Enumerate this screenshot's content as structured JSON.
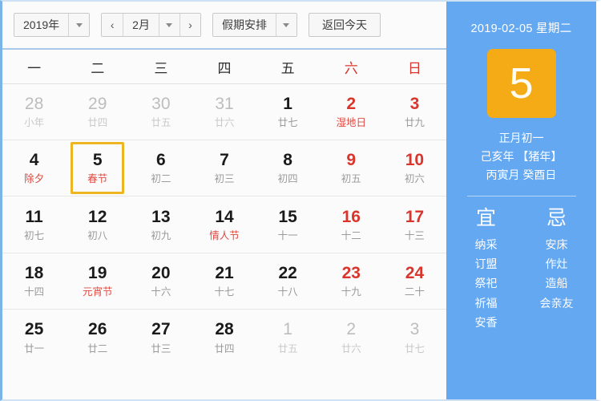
{
  "toolbar": {
    "year_label": "2019年",
    "year_caret": "chevron-down-icon",
    "prev_label": "‹",
    "month_label": "2月",
    "month_caret": "chevron-down-icon",
    "next_label": "›",
    "holiday_label": "假期安排",
    "holiday_caret": "chevron-down-icon",
    "today_label": "返回今天"
  },
  "weekdays": [
    {
      "label": "一",
      "weekend": false
    },
    {
      "label": "二",
      "weekend": false
    },
    {
      "label": "三",
      "weekend": false
    },
    {
      "label": "四",
      "weekend": false
    },
    {
      "label": "五",
      "weekend": false
    },
    {
      "label": "六",
      "weekend": true
    },
    {
      "label": "日",
      "weekend": true
    }
  ],
  "days": [
    {
      "num": "28",
      "sub": "小年",
      "muted": true,
      "num_red": false,
      "sub_red": false,
      "selected": false
    },
    {
      "num": "29",
      "sub": "廿四",
      "muted": true,
      "num_red": false,
      "sub_red": false,
      "selected": false
    },
    {
      "num": "30",
      "sub": "廿五",
      "muted": true,
      "num_red": false,
      "sub_red": false,
      "selected": false
    },
    {
      "num": "31",
      "sub": "廿六",
      "muted": true,
      "num_red": false,
      "sub_red": false,
      "selected": false
    },
    {
      "num": "1",
      "sub": "廿七",
      "muted": false,
      "num_red": false,
      "sub_red": false,
      "selected": false
    },
    {
      "num": "2",
      "sub": "湿地日",
      "muted": false,
      "num_red": true,
      "sub_red": true,
      "selected": false
    },
    {
      "num": "3",
      "sub": "廿九",
      "muted": false,
      "num_red": true,
      "sub_red": false,
      "selected": false
    },
    {
      "num": "4",
      "sub": "除夕",
      "muted": false,
      "num_red": false,
      "sub_red": true,
      "selected": false
    },
    {
      "num": "5",
      "sub": "春节",
      "muted": false,
      "num_red": false,
      "sub_red": true,
      "selected": true
    },
    {
      "num": "6",
      "sub": "初二",
      "muted": false,
      "num_red": false,
      "sub_red": false,
      "selected": false
    },
    {
      "num": "7",
      "sub": "初三",
      "muted": false,
      "num_red": false,
      "sub_red": false,
      "selected": false
    },
    {
      "num": "8",
      "sub": "初四",
      "muted": false,
      "num_red": false,
      "sub_red": false,
      "selected": false
    },
    {
      "num": "9",
      "sub": "初五",
      "muted": false,
      "num_red": true,
      "sub_red": false,
      "selected": false
    },
    {
      "num": "10",
      "sub": "初六",
      "muted": false,
      "num_red": true,
      "sub_red": false,
      "selected": false
    },
    {
      "num": "11",
      "sub": "初七",
      "muted": false,
      "num_red": false,
      "sub_red": false,
      "selected": false
    },
    {
      "num": "12",
      "sub": "初八",
      "muted": false,
      "num_red": false,
      "sub_red": false,
      "selected": false
    },
    {
      "num": "13",
      "sub": "初九",
      "muted": false,
      "num_red": false,
      "sub_red": false,
      "selected": false
    },
    {
      "num": "14",
      "sub": "情人节",
      "muted": false,
      "num_red": false,
      "sub_red": true,
      "selected": false
    },
    {
      "num": "15",
      "sub": "十一",
      "muted": false,
      "num_red": false,
      "sub_red": false,
      "selected": false
    },
    {
      "num": "16",
      "sub": "十二",
      "muted": false,
      "num_red": true,
      "sub_red": false,
      "selected": false
    },
    {
      "num": "17",
      "sub": "十三",
      "muted": false,
      "num_red": true,
      "sub_red": false,
      "selected": false
    },
    {
      "num": "18",
      "sub": "十四",
      "muted": false,
      "num_red": false,
      "sub_red": false,
      "selected": false
    },
    {
      "num": "19",
      "sub": "元宵节",
      "muted": false,
      "num_red": false,
      "sub_red": true,
      "selected": false
    },
    {
      "num": "20",
      "sub": "十六",
      "muted": false,
      "num_red": false,
      "sub_red": false,
      "selected": false
    },
    {
      "num": "21",
      "sub": "十七",
      "muted": false,
      "num_red": false,
      "sub_red": false,
      "selected": false
    },
    {
      "num": "22",
      "sub": "十八",
      "muted": false,
      "num_red": false,
      "sub_red": false,
      "selected": false
    },
    {
      "num": "23",
      "sub": "十九",
      "muted": false,
      "num_red": true,
      "sub_red": false,
      "selected": false
    },
    {
      "num": "24",
      "sub": "二十",
      "muted": false,
      "num_red": true,
      "sub_red": false,
      "selected": false
    },
    {
      "num": "25",
      "sub": "廿一",
      "muted": false,
      "num_red": false,
      "sub_red": false,
      "selected": false
    },
    {
      "num": "26",
      "sub": "廿二",
      "muted": false,
      "num_red": false,
      "sub_red": false,
      "selected": false
    },
    {
      "num": "27",
      "sub": "廿三",
      "muted": false,
      "num_red": false,
      "sub_red": false,
      "selected": false
    },
    {
      "num": "28",
      "sub": "廿四",
      "muted": false,
      "num_red": false,
      "sub_red": false,
      "selected": false
    },
    {
      "num": "1",
      "sub": "廿五",
      "muted": true,
      "num_red": false,
      "sub_red": false,
      "selected": false
    },
    {
      "num": "2",
      "sub": "廿六",
      "muted": true,
      "num_red": false,
      "sub_red": false,
      "selected": false
    },
    {
      "num": "3",
      "sub": "廿七",
      "muted": true,
      "num_red": false,
      "sub_red": false,
      "selected": false
    }
  ],
  "side": {
    "date_line": "2019-02-05 星期二",
    "big_day": "5",
    "lunar_day": "正月初一",
    "lunar_year": "己亥年 【猪年】",
    "lunar_ganzhi": "丙寅月 癸酉日",
    "yi": {
      "title": "宜",
      "items": [
        "纳采",
        "订盟",
        "祭祀",
        "祈福",
        "安香"
      ]
    },
    "ji": {
      "title": "忌",
      "items": [
        "安床",
        "作灶",
        "造船",
        "会亲友"
      ]
    }
  },
  "colors": {
    "panel_blue": "#64a8f2",
    "tile_orange": "#f5ab16",
    "selected_border": "#edb520",
    "holiday_red": "#d9352c",
    "page_bg": "#fbfbfb"
  }
}
